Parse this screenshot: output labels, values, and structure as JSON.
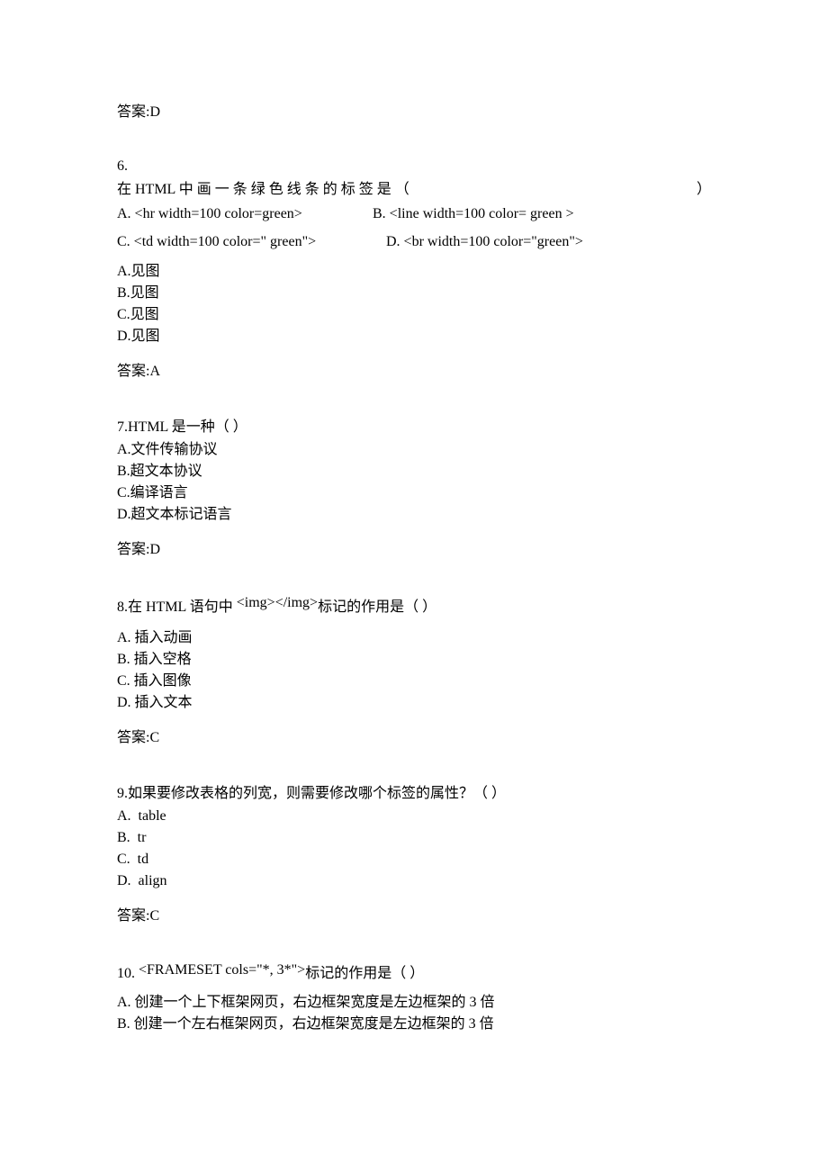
{
  "ans5": "答案:D",
  "q6": {
    "num": "6.",
    "stem_left": "在  HTML  中  画  一  条  绿  色  线  条  的  标  签  是   （",
    "stem_right": "）",
    "imgA": "A. <hr width=100 color=green>",
    "imgB": "B. <line width=100 color= green >",
    "imgC": "C. <td width=100 color=\" green\">",
    "imgD": "D. <br width=100 color=\"green\">",
    "optA": "A.见图",
    "optB": "B.见图",
    "optC": "C.见图",
    "optD": "D.见图",
    "answer": "答案:A"
  },
  "q7": {
    "stem": "7.HTML 是一种（  ）",
    "optA": "A.文件传输协议",
    "optB": "B.超文本协议",
    "optC": "C.编译语言",
    "optD": "D.超文本标记语言",
    "answer": "答案:D"
  },
  "q8": {
    "stem_before": "8.在 HTML 语句中",
    "stem_img": " <img></img>",
    "stem_after": "标记的作用是（       ）",
    "optA": "A.  插入动画",
    "optB": "B.  插入空格",
    "optC": "C.  插入图像",
    "optD": "D.  插入文本",
    "answer": "答案:C"
  },
  "q9": {
    "stem": "9.如果要修改表格的列宽，则需要修改哪个标签的属性？（    ）",
    "optA": "A. table",
    "optB": "B. tr",
    "optC": "C. td",
    "optD": "D. align",
    "answer": "答案:C"
  },
  "q10": {
    "stem_before": "10.  ",
    "stem_img": "<FRAMESET cols=\"*, 3*\">",
    "stem_after": "标记的作用是（       ）",
    "optA": "A.  创建一个上下框架网页，右边框架宽度是左边框架的 3 倍",
    "optB": "B.  创建一个左右框架网页，右边框架宽度是左边框架的 3 倍"
  }
}
